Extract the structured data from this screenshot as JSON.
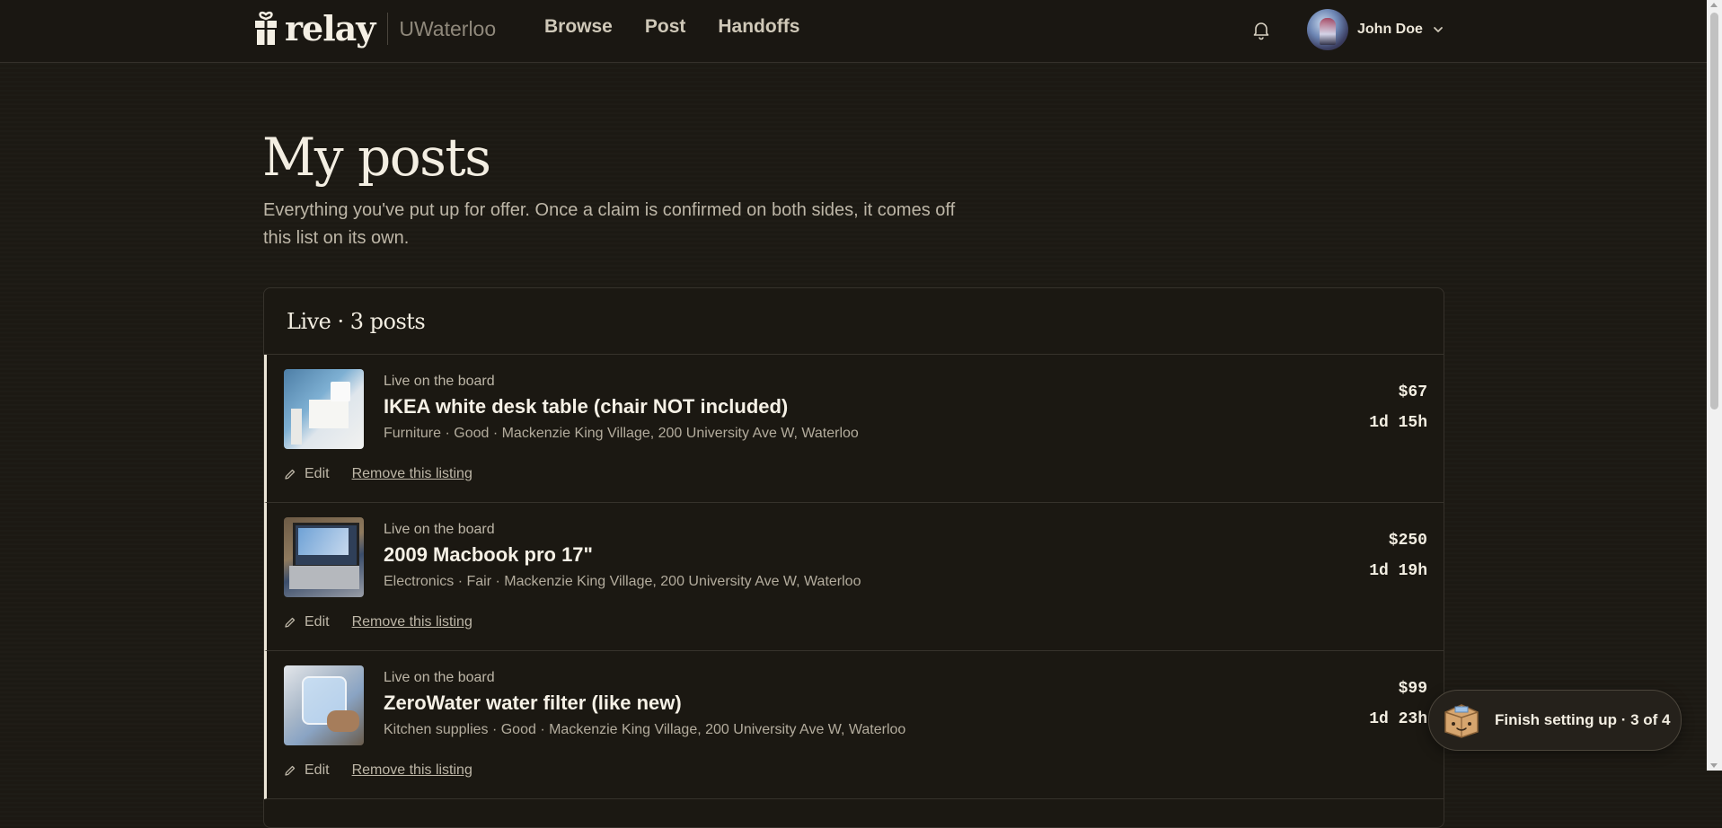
{
  "header": {
    "brand_name": "relay",
    "school": "UWaterloo",
    "nav": [
      "Browse",
      "Post",
      "Handoffs"
    ],
    "user_name": "John Doe"
  },
  "page": {
    "title": "My posts",
    "description": "Everything you've put up for offer. Once a claim is confirmed on both sides, it comes off this list on its own."
  },
  "panel": {
    "title": "Live · 3 posts"
  },
  "posts": [
    {
      "status": "Live on the board",
      "title": "IKEA white desk table (chair NOT included)",
      "meta": "Furniture · Good · Mackenzie King Village, 200 University Ave W, Waterloo",
      "price": "$67",
      "time_left": "1d 15h",
      "edit_label": "Edit",
      "remove_label": "Remove this listing",
      "image": "desk-photo"
    },
    {
      "status": "Live on the board",
      "title": "2009 Macbook pro 17\"",
      "meta": "Electronics · Fair · Mackenzie King Village, 200 University Ave W, Waterloo",
      "price": "$250",
      "time_left": "1d 19h",
      "edit_label": "Edit",
      "remove_label": "Remove this listing",
      "image": "laptop-photo"
    },
    {
      "status": "Live on the board",
      "title": "ZeroWater water filter (like new)",
      "meta": "Kitchen supplies · Good · Mackenzie King Village, 200 University Ave W, Waterloo",
      "price": "$99",
      "time_left": "1d 23h",
      "edit_label": "Edit",
      "remove_label": "Remove this listing",
      "image": "water-filter-photo"
    }
  ],
  "setup": {
    "label": "Finish setting up · 3 of 4",
    "icon": "box-mascot-icon"
  },
  "colors": {
    "background": "#1c1913",
    "text": "#ece6d8",
    "muted": "#bdb6a7",
    "border": "#36322b"
  }
}
